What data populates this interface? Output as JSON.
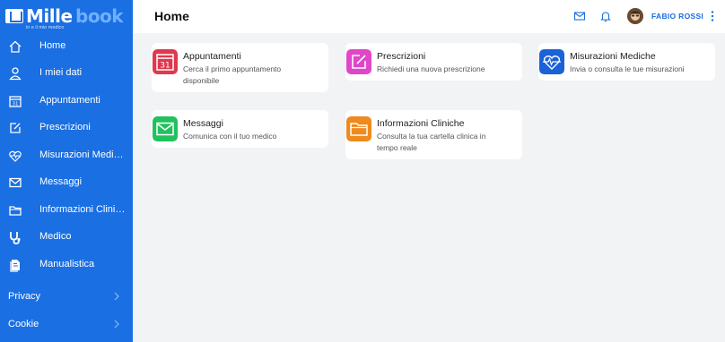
{
  "brand": {
    "name_part1": "Mille",
    "name_part2": "book",
    "tagline": "in e il mio medico"
  },
  "sidebar": {
    "items": [
      {
        "label": "Home",
        "icon": "home-icon"
      },
      {
        "label": "I miei dati",
        "icon": "user-icon"
      },
      {
        "label": "Appuntamenti",
        "icon": "calendar-icon"
      },
      {
        "label": "Prescrizioni",
        "icon": "edit-icon"
      },
      {
        "label": "Misurazioni Mediche",
        "icon": "heart-pulse-icon"
      },
      {
        "label": "Messaggi",
        "icon": "mail-icon"
      },
      {
        "label": "Informazioni Cliniche",
        "icon": "folder-icon"
      },
      {
        "label": "Medico",
        "icon": "stethoscope-icon"
      },
      {
        "label": "Manualistica",
        "icon": "book-icon"
      }
    ],
    "sections": [
      {
        "label": "Privacy"
      },
      {
        "label": "Cookie"
      }
    ]
  },
  "header": {
    "title": "Home",
    "user_name": "FABIO ROSSI"
  },
  "cards": [
    {
      "title": "Appuntamenti",
      "description": "Cerca il primo appuntamento disponibile",
      "color": "#e0384e",
      "icon": "calendar-31-icon"
    },
    {
      "title": "Prescrizioni",
      "description": "Richiedi una nuova prescrizione",
      "color": "#e046c8",
      "icon": "edit-icon"
    },
    {
      "title": "Misurazioni Mediche",
      "description": "Invia o consulta le tue misurazioni",
      "color": "#1a62d8",
      "icon": "heart-pulse-icon"
    },
    {
      "title": "Messaggi",
      "description": "Comunica con il tuo medico",
      "color": "#22c15e",
      "icon": "mail-icon"
    },
    {
      "title": "Informazioni Cliniche",
      "description": "Consulta la tua cartella clinica in tempo reale",
      "color": "#ee8a1e",
      "icon": "folder-icon"
    }
  ],
  "colors": {
    "sidebar": "#1a6fe2",
    "background": "#f2f3f5",
    "accent": "#1a6fe2"
  }
}
